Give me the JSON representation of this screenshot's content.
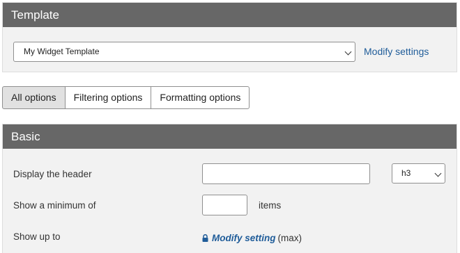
{
  "template": {
    "header_title": "Template",
    "select_value": "My Widget Template",
    "modify_link": "Modify settings"
  },
  "tabs": [
    {
      "label": "All options",
      "active": true
    },
    {
      "label": "Filtering options",
      "active": false
    },
    {
      "label": "Formatting options",
      "active": false
    }
  ],
  "basic": {
    "header_title": "Basic",
    "display_header_label": "Display the header",
    "header_text_value": "",
    "header_level_value": "h3",
    "min_label": "Show a minimum of",
    "min_value": "",
    "items_label": "items",
    "upto_label": "Show up to",
    "modify_setting_link": "Modify setting",
    "max_note": "(max)"
  },
  "colors": {
    "header_bg": "#676767",
    "panel_bg": "#f2f2f2",
    "link": "#1f5c99",
    "active_tab_bg": "#e1e1e1"
  },
  "icons": {
    "lock": "lock-icon",
    "select_caret": "chevron-down-icon"
  }
}
